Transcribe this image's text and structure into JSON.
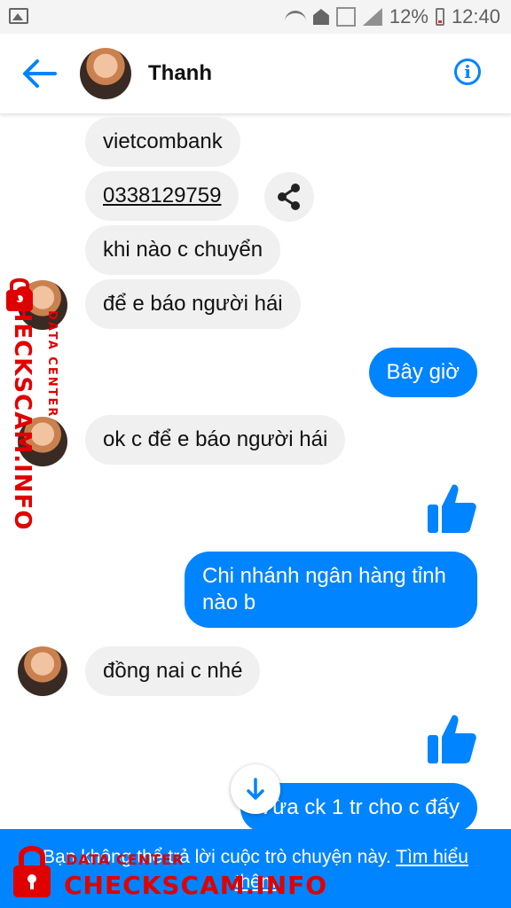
{
  "status_bar": {
    "battery": "12%",
    "time": "12:40"
  },
  "header": {
    "contact_name": "Thanh",
    "back_icon": "arrow-left-icon",
    "info_icon": "info-icon",
    "accent_color": "#0084ff"
  },
  "messages": [
    {
      "side": "in",
      "text": "vietcombank"
    },
    {
      "side": "in",
      "text": "0338129759",
      "type": "phone"
    },
    {
      "side": "in",
      "text": "khi nào c chuyển"
    },
    {
      "side": "in",
      "text": "để e báo người hái"
    },
    {
      "side": "out",
      "text": "Bây giờ"
    },
    {
      "side": "in",
      "text": "ok c để e báo người hái"
    },
    {
      "side": "out",
      "type": "like"
    },
    {
      "side": "out",
      "text": "Chi nhánh ngân hàng tỉnh nào b",
      "line1": "Chi nhánh ngân hàng tỉnh",
      "line2": "nào b"
    },
    {
      "side": "in",
      "text": "đồng nai c nhé"
    },
    {
      "side": "out",
      "type": "like"
    },
    {
      "side": "out",
      "text": "Vừa ck 1 tr cho c đấy"
    }
  ],
  "banner": {
    "text": "Bạn không thể trả lời cuộc trò chuyện này.",
    "link": "Tìm hiểu thêm"
  },
  "watermark": {
    "brand": "CHECKSCAM.INFO",
    "sub": "DATA CENTER"
  }
}
